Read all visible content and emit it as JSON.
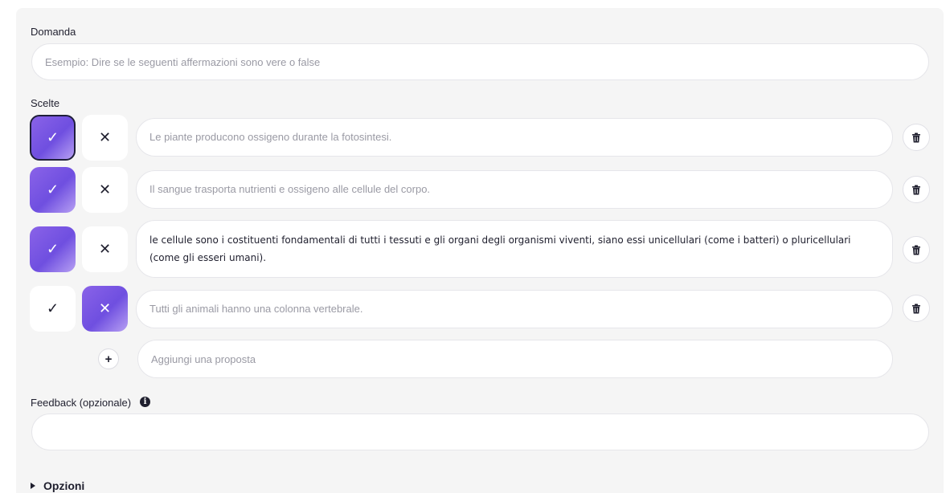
{
  "question": {
    "label": "Domanda",
    "placeholder": "Esempio: Dire se le seguenti affermazioni sono vere o false"
  },
  "choices": {
    "label": "Scelte",
    "items": [
      {
        "text": "Le piante producono ossigeno durante la fotosintesi.",
        "filled": false,
        "answer": "true"
      },
      {
        "text": "Il sangue trasporta nutrienti e ossigeno alle cellule del corpo.",
        "filled": false,
        "answer": "true"
      },
      {
        "text": "le cellule sono i costituenti fondamentali di tutti i tessuti e gli organi degli organismi viventi, siano essi unicellulari (come i batteri) o pluricellulari (come gli esseri umani).",
        "filled": true,
        "answer": "true"
      },
      {
        "text": "Tutti gli animali hanno una colonna vertebrale.",
        "filled": false,
        "answer": "false"
      }
    ],
    "add_placeholder": "Aggiungi una proposta",
    "true_icon": "check-icon",
    "false_icon": "x-icon"
  },
  "feedback": {
    "label": "Feedback (opzionale)",
    "info_glyph": "i",
    "value": ""
  },
  "options": {
    "label": "Opzioni"
  },
  "colors": {
    "accent": "#7b5ae6",
    "panel": "#f5f5f5"
  }
}
